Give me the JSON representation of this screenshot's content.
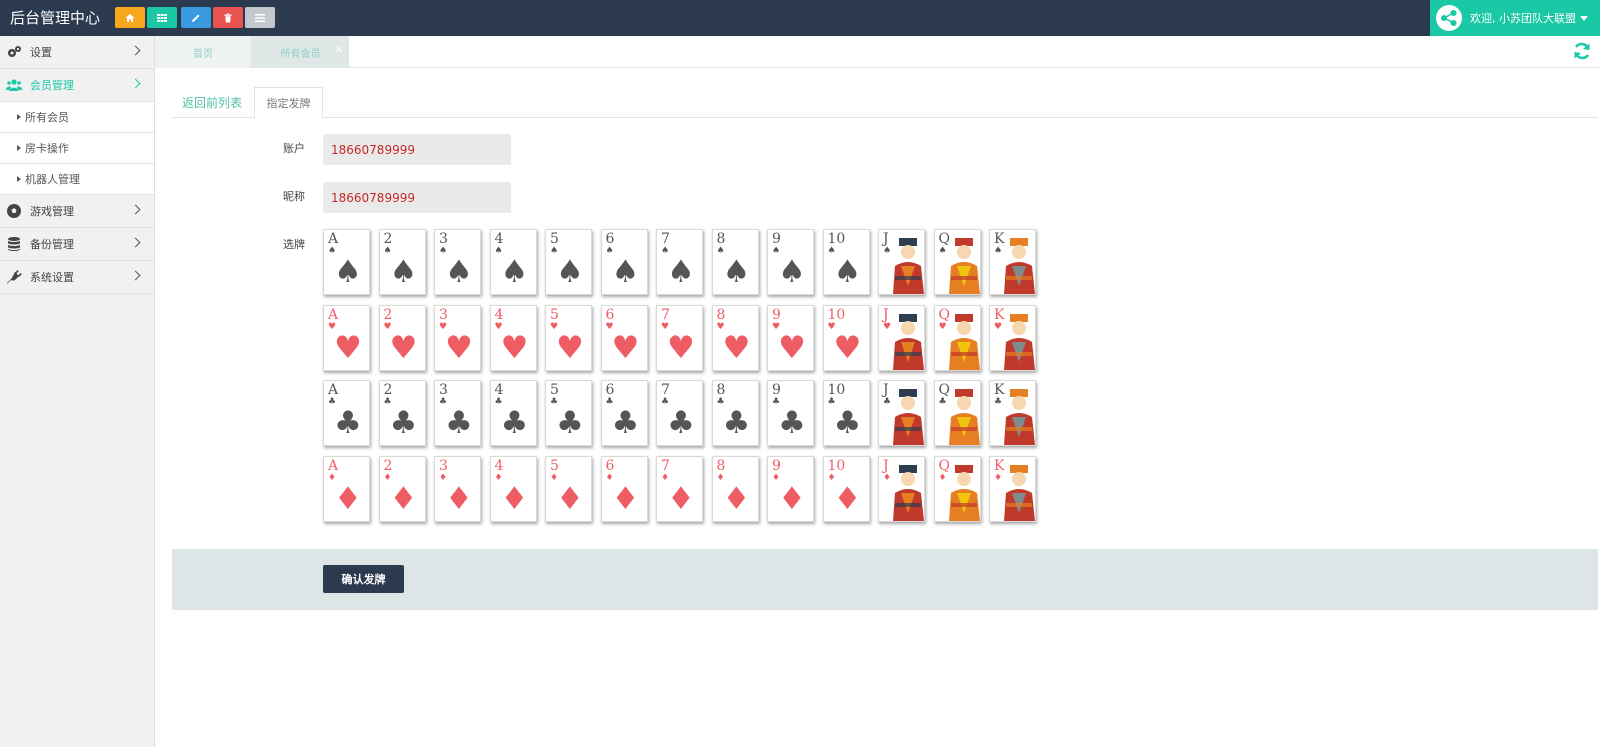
{
  "app": {
    "title": "后台管理中心",
    "welcome": "欢迎, 小苏团队大联盟"
  },
  "quick_buttons": [
    {
      "icon": "home-icon",
      "color": "#f7a71c"
    },
    {
      "icon": "grid-icon",
      "color": "#1ac8a6"
    },
    {
      "icon": "pencil-icon",
      "color": "#3a9ae0"
    },
    {
      "icon": "trash-icon",
      "color": "#e9534f"
    },
    {
      "icon": "list-icon",
      "color": "#c3c7ce"
    }
  ],
  "sidebar": {
    "items": [
      {
        "label": "设置",
        "icon": "gears-icon"
      },
      {
        "label": "会员管理",
        "icon": "users-icon",
        "active": true
      },
      {
        "label": "游戏管理",
        "icon": "soccer-ball-icon"
      },
      {
        "label": "备份管理",
        "icon": "database-icon"
      },
      {
        "label": "系统设置",
        "icon": "plug-icon"
      }
    ],
    "sub_items": [
      {
        "label": "所有会员"
      },
      {
        "label": "房卡操作"
      },
      {
        "label": "机器人管理"
      }
    ]
  },
  "page_tabs": [
    {
      "label": "首页"
    },
    {
      "label": "所有会员",
      "close": "×"
    }
  ],
  "content_tabs": {
    "back_label": "返回前列表",
    "deal_label": "指定发牌"
  },
  "form": {
    "account_label": "账户",
    "account_value": "18660789999",
    "nickname_label": "昵称",
    "nickname_value": "18660789999",
    "cards_label": "选牌"
  },
  "cards": {
    "ranks": [
      "A",
      "2",
      "3",
      "4",
      "5",
      "6",
      "7",
      "8",
      "9",
      "10",
      "J",
      "Q",
      "K"
    ],
    "suits": [
      {
        "name": "spades",
        "symbol": "♠",
        "color": "black"
      },
      {
        "name": "hearts",
        "symbol": "♥",
        "color": "red"
      },
      {
        "name": "clubs",
        "symbol": "♣",
        "color": "black"
      },
      {
        "name": "diamonds",
        "symbol": "♦",
        "color": "red"
      }
    ]
  },
  "confirm_button": "确认发牌"
}
